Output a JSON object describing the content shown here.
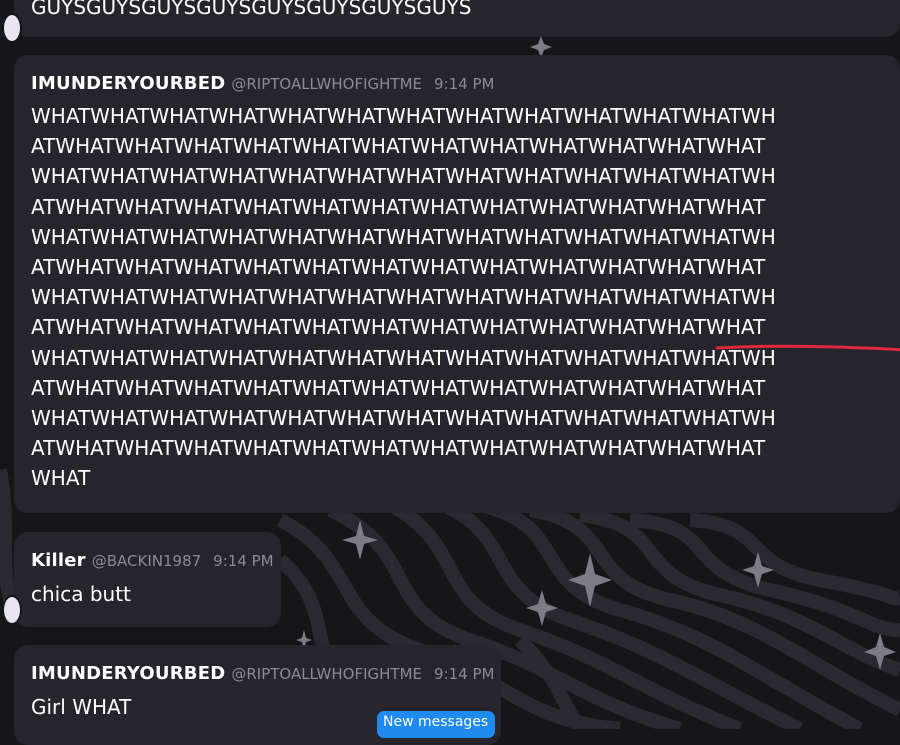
{
  "messages": [
    {
      "text_lines": [
        "GUYSGUYSGUYSGUYSGUYSGUYSGUYSGUYS"
      ]
    },
    {
      "username": "IMUNDERYOURBED",
      "handle": "@RIPTOALLWHOFIGHTME",
      "time": "9:14 PM",
      "text_lines": [
        "WHATWHATWHATWHATWHATWHATWHATWHATWHATWHATWHATWHATWH",
        "ATWHATWHATWHATWHATWHATWHATWHATWHATWHATWHATWHATWHAT",
        "WHATWHATWHATWHATWHATWHATWHATWHATWHATWHATWHATWHATWH",
        "ATWHATWHATWHATWHATWHATWHATWHATWHATWHATWHATWHATWHAT",
        "WHATWHATWHATWHATWHATWHATWHATWHATWHATWHATWHATWHATWH",
        "ATWHATWHATWHATWHATWHATWHATWHATWHATWHATWHATWHATWHAT",
        "WHATWHATWHATWHATWHATWHATWHATWHATWHATWHATWHATWHATWH",
        "ATWHATWHATWHATWHATWHATWHATWHATWHATWHATWHATWHATWHAT",
        "WHATWHATWHATWHATWHATWHATWHATWHATWHATWHATWHATWHATWH",
        "ATWHATWHATWHATWHATWHATWHATWHATWHATWHATWHATWHATWHAT",
        "WHATWHATWHATWHATWHATWHATWHATWHATWHATWHATWHATWHATWH",
        "ATWHATWHATWHATWHATWHATWHATWHATWHATWHATWHATWHATWHAT",
        "WHAT"
      ]
    },
    {
      "username": "Killer",
      "handle": "@BACKIN1987",
      "time": "9:14 PM",
      "text_lines": [
        "chica butt"
      ]
    },
    {
      "username": "IMUNDERYOURBED",
      "handle": "@RIPTOALLWHOFIGHTME",
      "time": "9:14 PM",
      "text_lines": [
        "Girl WHAT"
      ]
    }
  ],
  "new_messages_label": "New messages",
  "colors": {
    "background": "#161519",
    "bubble": "#26252b",
    "accent_blue": "#1f8bf0",
    "annotation_red": "#e0283c",
    "muted_text": "#8c8a93"
  },
  "decorations": {
    "pattern": "wavy-stripes",
    "icon": "sparkle-star-icon"
  }
}
